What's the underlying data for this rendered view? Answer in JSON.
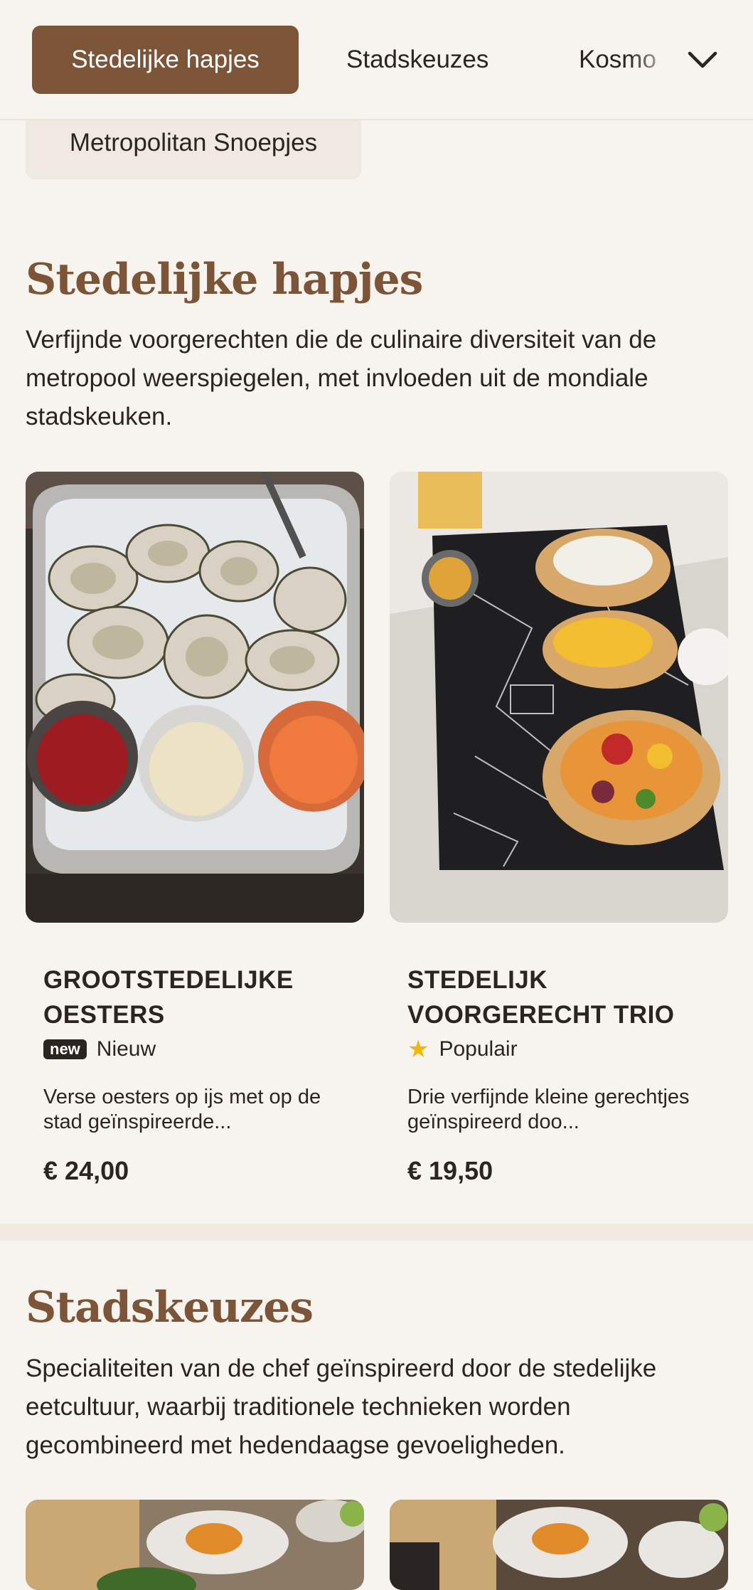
{
  "nav": {
    "tabs": [
      {
        "label": "Stedelijke hapjes",
        "active": true
      },
      {
        "label": "Stadskeuzes",
        "active": false
      },
      {
        "label": "Kosmo",
        "active": false
      }
    ],
    "chip": "Metropolitan Snoepjes",
    "dropdown_icon": "chevron-down-icon"
  },
  "sections": [
    {
      "title": "Stedelijke hapjes",
      "description": "Verfijnde voorgerechten die de culinaire diversiteit van de metropool weerspiegelen, met invloeden uit de mondiale stadskeuken.",
      "items": [
        {
          "name": "Grootstedelijke Oesters",
          "badge": "new",
          "badge_label": "Nieuw",
          "description": "Verse oesters op ijs met op de stad geïnspireerde...",
          "price": "€ 24,00"
        },
        {
          "name": "Stedelijk Voorgerecht Trio",
          "badge": "star-icon",
          "badge_label": "Populair",
          "description": "Drie verfijnde kleine gerechtjes geïnspireerd doo...",
          "price": "€ 19,50"
        }
      ]
    },
    {
      "title": "Stadskeuzes",
      "description": "Specialiteiten van de chef geïnspireerd door de stedelijke eetcultuur, waarbij traditionele technieken worden gecombineerd met hedendaagse gevoeligheden."
    }
  ],
  "colors": {
    "accent": "#7c5437",
    "background": "#f7f3ee",
    "star": "#f2b705"
  }
}
